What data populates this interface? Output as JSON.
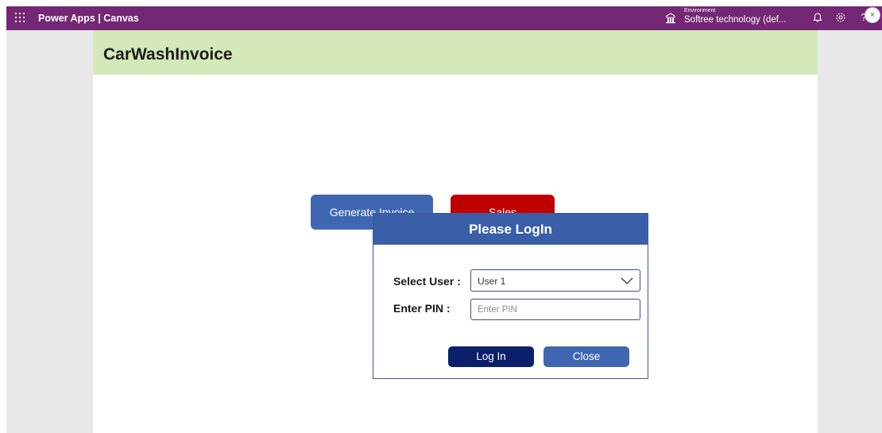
{
  "topbar": {
    "app_title": "Power Apps  |  Canvas",
    "environment_label": "Environment",
    "environment_value": "Softree technology (def...",
    "icons": [
      "waffle-icon",
      "environment-icon",
      "notification-bell-icon",
      "settings-gear-icon",
      "help-icon"
    ],
    "help_label": "?",
    "color": "#742774"
  },
  "app": {
    "title": "CarWashInvoice",
    "header_color": "#d4e8b9",
    "buttons": {
      "generate_invoice": "Generate Invoice",
      "sales": "Sales"
    }
  },
  "login_dialog": {
    "title": "Please LogIn",
    "select_user_label": "Select User :",
    "select_user_value": "User 1",
    "enter_pin_label": "Enter PIN :",
    "pin_placeholder": "Enter PIN",
    "login_button": "Log In",
    "close_button": "Close"
  },
  "side_panel": {
    "collapse_label": "×"
  }
}
